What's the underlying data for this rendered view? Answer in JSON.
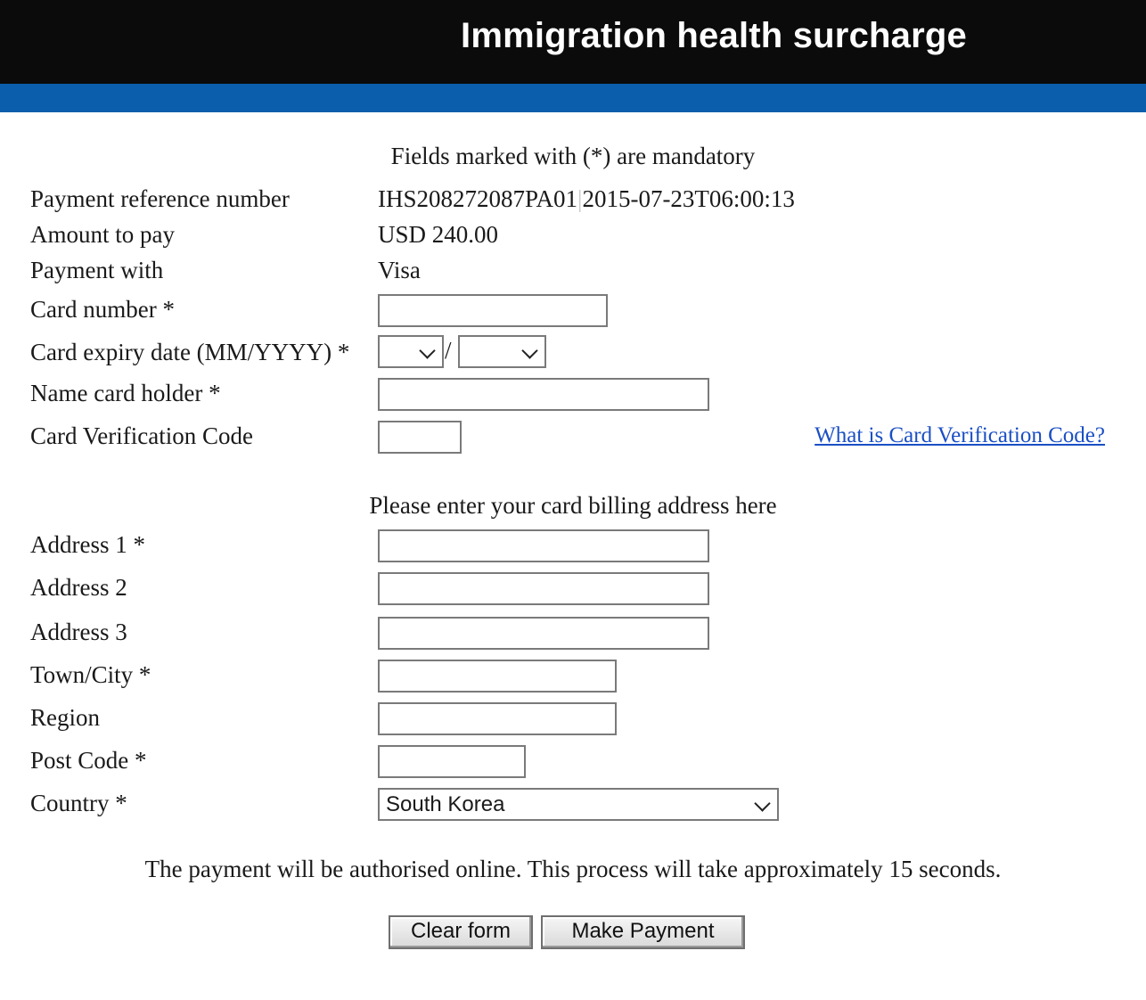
{
  "header": {
    "title": "Immigration health surcharge"
  },
  "notes": {
    "mandatory": "Fields marked with (*) are mandatory",
    "billing": "Please enter your card billing address here",
    "authorisation": "The payment will be authorised online. This process will take approximately 15 seconds."
  },
  "payment": {
    "reference_label": "Payment reference number",
    "reference_id": "IHS208272087PA01",
    "reference_sep": "|",
    "reference_time": "2015-07-23T06:00:13",
    "amount_label": "Amount to pay",
    "amount_value": "USD 240.00",
    "method_label": "Payment with",
    "method_value": "Visa"
  },
  "card": {
    "number_label": "Card number *",
    "number_value": "",
    "expiry_label": "Card expiry date (MM/YYYY) *",
    "expiry_month": "",
    "expiry_separator": "/",
    "expiry_year": "",
    "holder_label": "Name card holder *",
    "holder_value": "",
    "cvc_label": "Card Verification Code",
    "cvc_value": "",
    "cvc_help_link": "What is Card Verification Code?"
  },
  "billing": {
    "address1_label": "Address 1 *",
    "address1_value": "",
    "address2_label": "Address 2",
    "address2_value": "",
    "address3_label": "Address 3",
    "address3_value": "",
    "city_label": "Town/City *",
    "city_value": "",
    "region_label": "Region",
    "region_value": "",
    "postcode_label": "Post Code *",
    "postcode_value": "",
    "country_label": "Country *",
    "country_value": "South Korea"
  },
  "buttons": {
    "clear": "Clear form",
    "submit": "Make Payment"
  },
  "colors": {
    "header_bg": "#0b0b0b",
    "header_stripe": "#0a5eab",
    "link": "#1a4fc4"
  },
  "icons": {
    "dropdown": "chevron-down-icon"
  }
}
